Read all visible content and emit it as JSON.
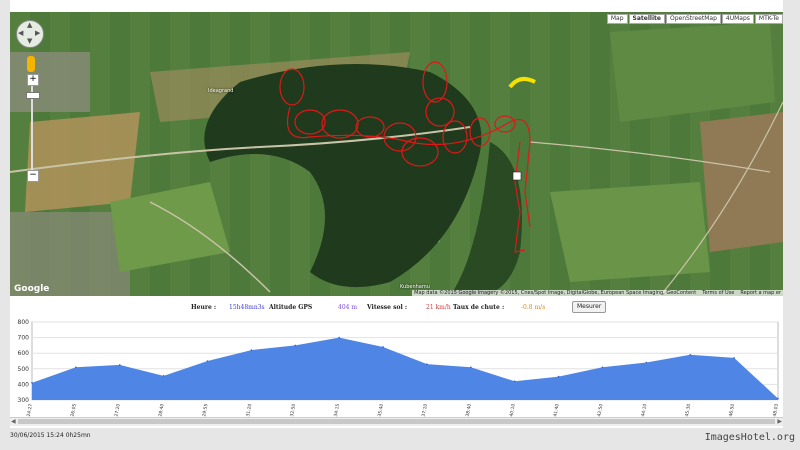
{
  "map": {
    "map_types": [
      "Map",
      "Satellite",
      "OpenStreetMap",
      "4UMaps",
      "MTK-Te"
    ],
    "active_type": "Satellite",
    "google_logo": "Google",
    "attribution": "Map data ©2015 Google Imagery ©2015, Cnes/Spot Image, DigitalGlobe, European Space Imaging, GeoContent",
    "terms": "Terms of Use",
    "report": "Report a map er",
    "place_labels": [
      "Ideagrand",
      "Kubenhamu"
    ],
    "colors": {
      "track": "#e01818",
      "glider": "#f5e000"
    }
  },
  "status": {
    "time_label": "Heure :",
    "time_value": "15h48mn3s",
    "alt_label": "Altitude GPS",
    "alt_value": "404 m",
    "speed_label": "Vitesse sol :",
    "speed_value": "21 km/h",
    "rate_label": "Taux de chute :",
    "rate_value": "-0.8 m/s",
    "measure_label": "Mesurer"
  },
  "footer": {
    "timestamp": "30/06/2015 15:24 0h25mn",
    "watermark": "ImagesHotel.org"
  },
  "chart_data": {
    "type": "area",
    "ylim": [
      300,
      800
    ],
    "yticks": [
      300,
      400,
      500,
      600,
      700,
      800
    ],
    "x": [
      "15:24:27",
      "15:26:05",
      "15:27:20",
      "15:28:40",
      "15:29:55",
      "15:31:20",
      "15:32:50",
      "15:34:15",
      "15:35:40",
      "15:37:10",
      "15:38:40",
      "15:40:10",
      "15:41:40",
      "15:42:50",
      "15:44:10",
      "15:45:30",
      "15:46:50",
      "15:48:03"
    ],
    "values": [
      410,
      510,
      525,
      455,
      550,
      620,
      650,
      700,
      640,
      530,
      510,
      420,
      450,
      510,
      540,
      590,
      570,
      310
    ],
    "color": "#4f86e6"
  }
}
